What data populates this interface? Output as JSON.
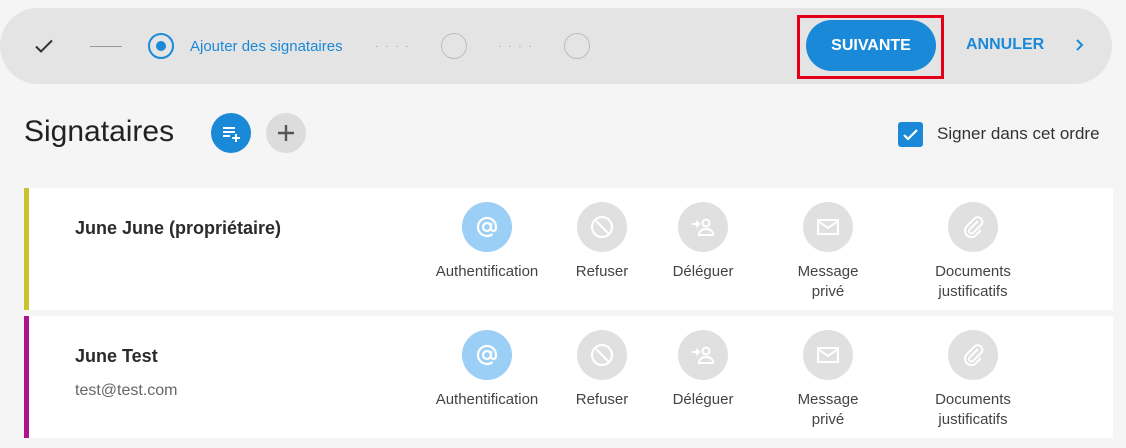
{
  "stepper": {
    "done_icon": "check-icon",
    "active_label": "Ajouter des signataires",
    "dots": "· · · ·"
  },
  "actions": {
    "next_label": "SUIVANTE",
    "cancel_label": "ANNULER"
  },
  "section": {
    "title": "Signataires",
    "sign_in_order_label": "Signer dans cet ordre",
    "sign_in_order_checked": true
  },
  "signers": [
    {
      "name": "June June (propriétaire)",
      "email": "",
      "accent": "#c8c430"
    },
    {
      "name": "June Test",
      "email": "test@test.com",
      "accent": "#b0128f"
    }
  ],
  "signer_actions": {
    "auth": "Authentification",
    "refuse": "Refuser",
    "delegate": "Déléguer",
    "message_l1": "Message",
    "message_l2": "privé",
    "docs_l1": "Documents",
    "docs_l2": "justificatifs"
  },
  "colors": {
    "primary": "#1a8ad8",
    "highlight": "#e2001a"
  }
}
